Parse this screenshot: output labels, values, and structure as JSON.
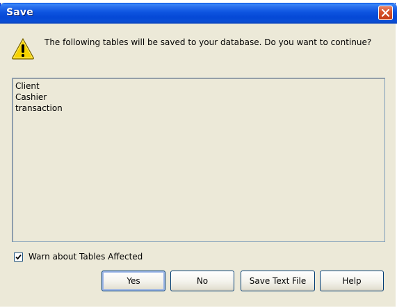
{
  "window": {
    "title": "Save",
    "close_icon": "close-icon"
  },
  "dialog": {
    "icon": "warning-icon",
    "message": "The following tables will be saved to your database. Do you want to continue?",
    "tables": [
      "Client",
      "Cashier",
      "transaction"
    ],
    "warn_checkbox": {
      "label": "Warn about Tables Affected",
      "checked": true
    }
  },
  "buttons": {
    "yes": "Yes",
    "no": "No",
    "save_text_file": "Save Text File",
    "help": "Help"
  },
  "colors": {
    "titlebar": "#0548d6",
    "dialog_bg": "#ece9d8",
    "close_button": "#d8562f",
    "warning_yellow": "#f7d300"
  }
}
